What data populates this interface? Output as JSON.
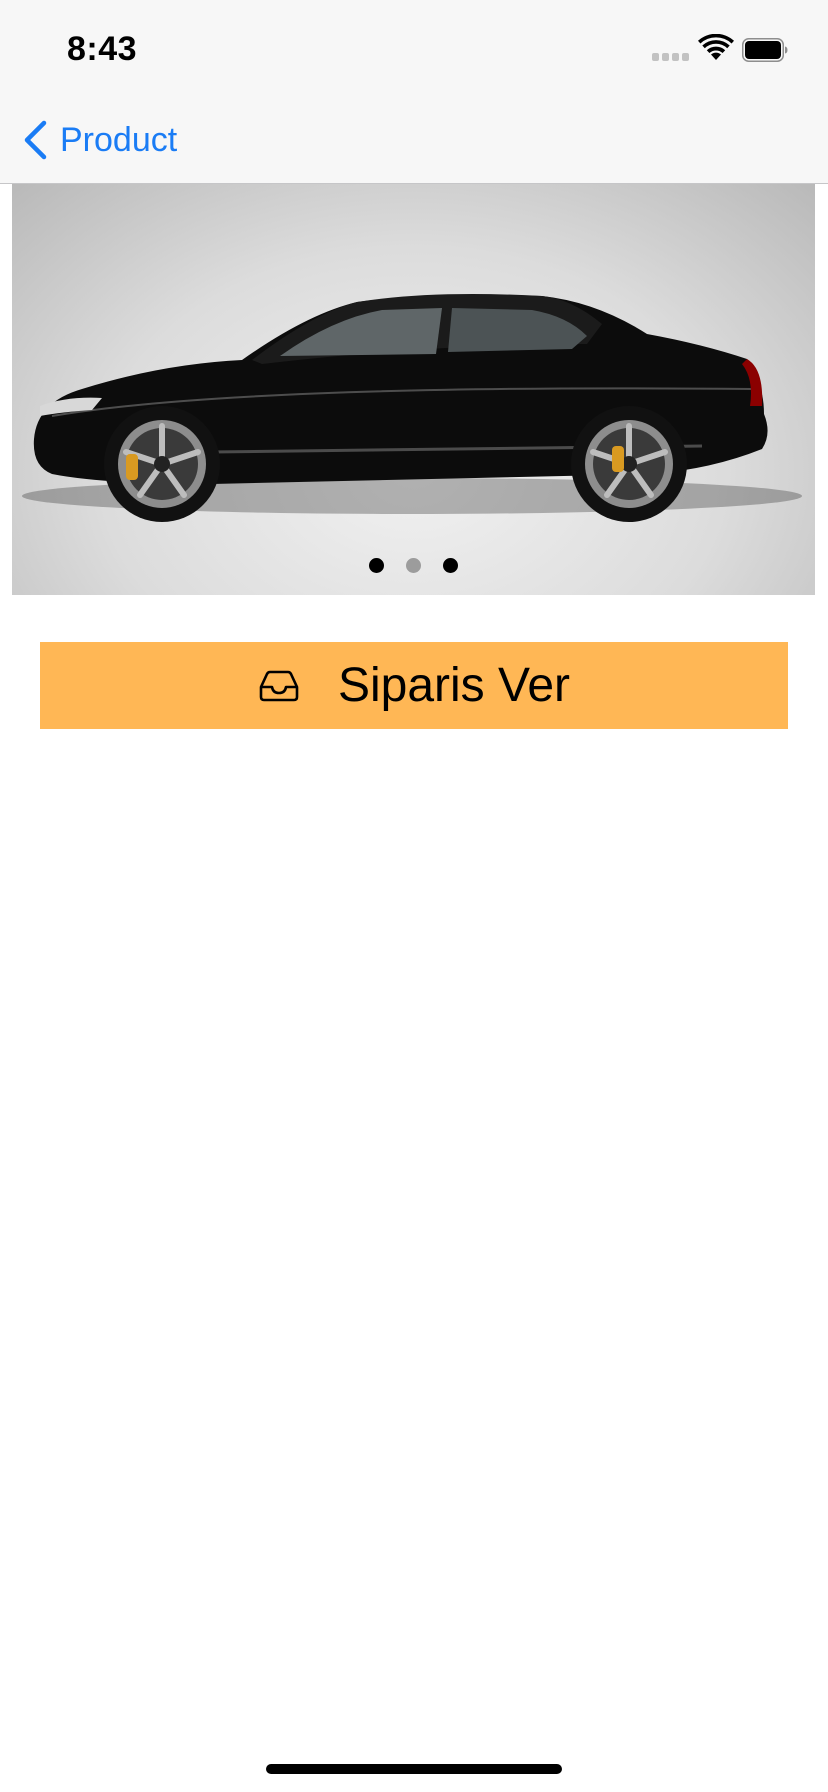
{
  "status_bar": {
    "time": "8:43",
    "signal_icon": "cellular-signal-icon",
    "wifi_icon": "wifi-icon",
    "battery_icon": "battery-icon"
  },
  "nav_bar": {
    "back_icon": "chevron-left-icon",
    "back_label": "Product",
    "accent_color": "#1a7cf5"
  },
  "carousel": {
    "image": "black-sedan-car-photo",
    "page_count": 3,
    "current_page": 2,
    "dot_colors": {
      "active": "#000000",
      "inactive": "#9c9c9c"
    }
  },
  "order_button": {
    "icon": "tray-icon",
    "label": "Siparis Ver",
    "background_color": "#ffb755"
  }
}
